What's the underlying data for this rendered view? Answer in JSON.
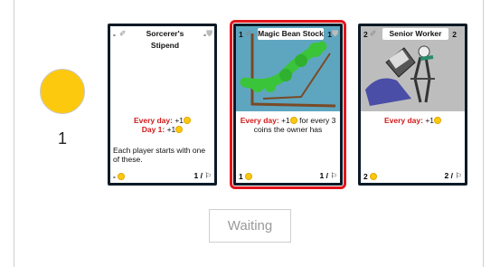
{
  "player": {
    "coins": "1",
    "coin_color": "#fdc90f"
  },
  "cards": [
    {
      "cost": "-",
      "title": "Sorcerer's Stipend",
      "number": "-",
      "effects": [
        {
          "label": "Every day:",
          "value": "+1"
        },
        {
          "label": "Day 1:",
          "value": "+1"
        }
      ],
      "description": "Each player starts with one of these.",
      "bottom_left": "-",
      "bottom_right": "1 /"
    },
    {
      "cost": "1",
      "title": "Magic Bean Stock",
      "number": "1",
      "effects": [
        {
          "label": "Every day:",
          "value": "+1",
          "suffix": "for every 3 coins the owner has"
        }
      ],
      "bottom_left": "1",
      "bottom_right": "1 /",
      "selected": true
    },
    {
      "cost": "2",
      "title": "Senior Worker",
      "number": "2",
      "effects": [
        {
          "label": "Every day:",
          "value": "+1"
        }
      ],
      "bottom_left": "2",
      "bottom_right": "2 /"
    }
  ],
  "status": {
    "waiting_label": "Waiting"
  },
  "colors": {
    "selection": "#e3141b",
    "card_border": "#0a1a26",
    "highlight_text": "#d11a1a"
  }
}
